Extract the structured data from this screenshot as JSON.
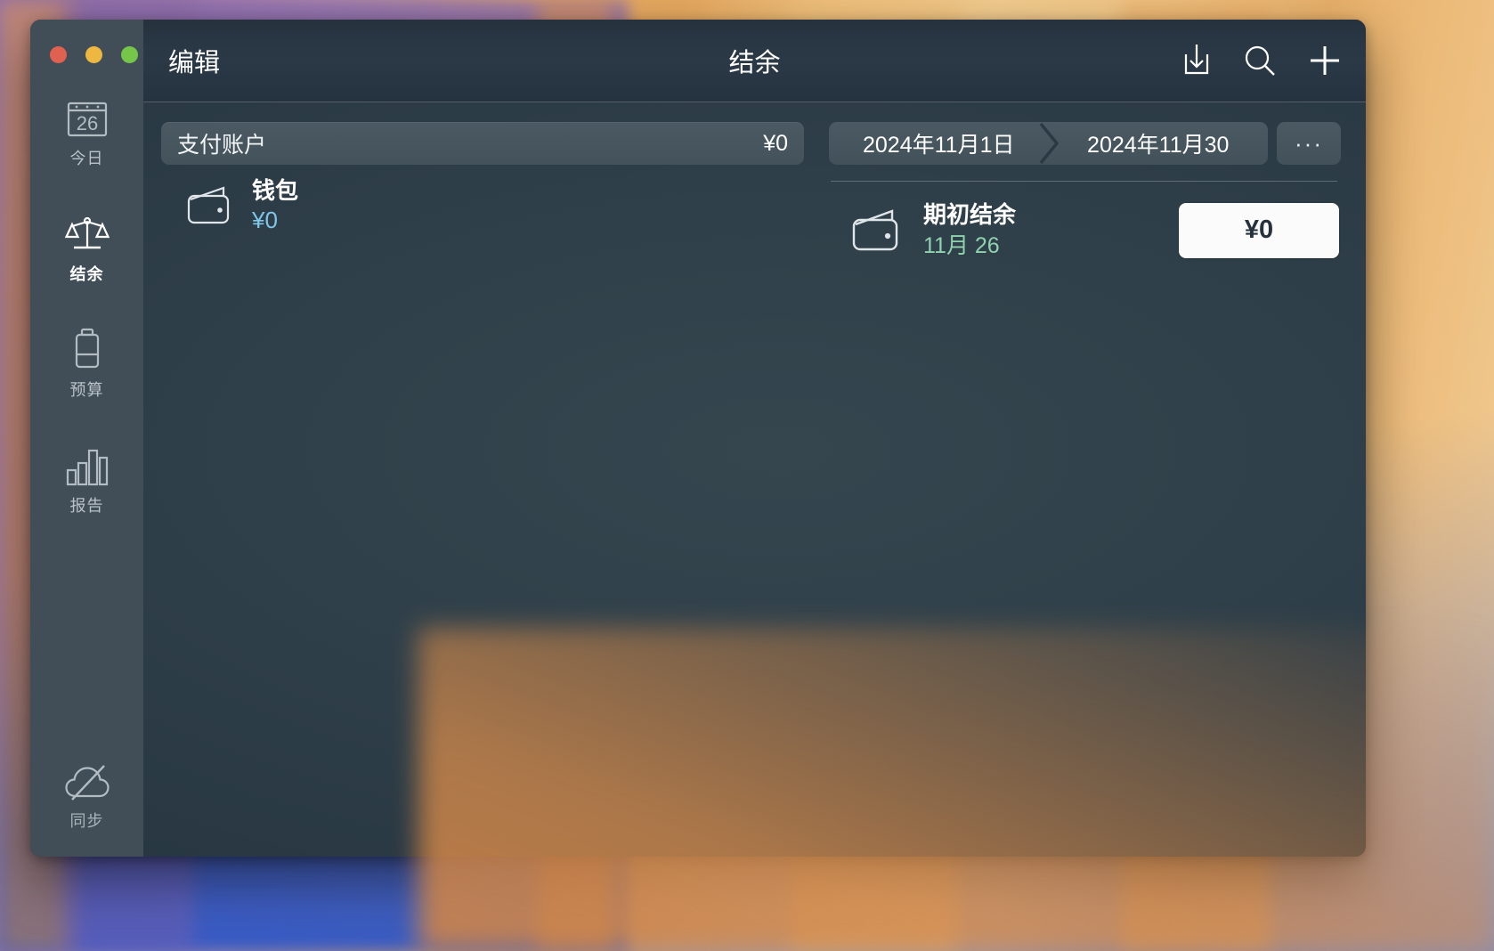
{
  "window": {
    "traffic_lights": [
      {
        "name": "close",
        "color": "#e0614f"
      },
      {
        "name": "minimize",
        "color": "#edb740"
      },
      {
        "name": "zoom",
        "color": "#76c64a"
      }
    ],
    "edit_label": "编辑",
    "title": "结余"
  },
  "titlebar_actions": [
    {
      "name": "import-icon",
      "label": "导入"
    },
    {
      "name": "search-icon",
      "label": "搜索"
    },
    {
      "name": "add-icon",
      "label": "添加"
    }
  ],
  "sidebar": {
    "items": [
      {
        "label": "今日",
        "icon": "calendar-icon",
        "badge": "26",
        "active": false
      },
      {
        "label": "结余",
        "icon": "scale-icon",
        "active": true
      },
      {
        "label": "预算",
        "icon": "battery-icon",
        "active": false
      },
      {
        "label": "报告",
        "icon": "bar-chart-icon",
        "active": false
      }
    ],
    "sync": {
      "label": "同步",
      "icon": "cloud-slash-icon"
    }
  },
  "accounts_pane": {
    "group": {
      "name": "支付账户",
      "amount": "¥0"
    },
    "rows": [
      {
        "icon": "wallet-icon",
        "name": "钱包",
        "amount": "¥0"
      }
    ]
  },
  "detail_pane": {
    "date_range": {
      "start": "2024年11月1日",
      "end": "2024年11月30"
    },
    "more_label": "···",
    "entries": [
      {
        "icon": "wallet-icon",
        "title": "期初结余",
        "date": "11月 26",
        "amount": "¥0"
      }
    ]
  },
  "colors": {
    "accent_blue": "#7fc6e8",
    "accent_green": "#8fd3ae",
    "sidebar_bg": "#414e57",
    "content_bg": "#2f3f49"
  }
}
